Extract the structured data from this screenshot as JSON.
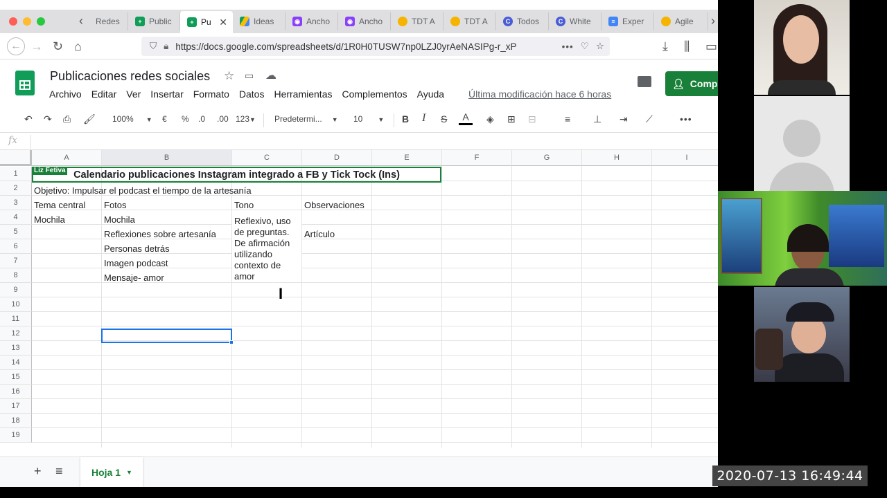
{
  "browser": {
    "tabs": [
      {
        "label": "Redes",
        "icon": "back-arrow",
        "color": "#9aa0a6"
      },
      {
        "label": "Public",
        "icon": "sheets-icon",
        "color": "#0f9d58"
      },
      {
        "label": "Pu",
        "icon": "sheets-icon",
        "color": "#0f9d58"
      },
      {
        "label": "Ideas",
        "icon": "drive-icon",
        "color": "#fbbc04"
      },
      {
        "label": "Ancho",
        "icon": "anchor-icon",
        "color": "#8940fa"
      },
      {
        "label": "Ancho",
        "icon": "anchor-icon",
        "color": "#8940fa"
      },
      {
        "label": "TDT A",
        "icon": "medal-icon",
        "color": "#f4b400"
      },
      {
        "label": "TDT A",
        "icon": "medal-icon",
        "color": "#f4b400"
      },
      {
        "label": "Todos",
        "icon": "c-icon",
        "color": "#4a5cd6"
      },
      {
        "label": "White",
        "icon": "c-icon",
        "color": "#4a5cd6"
      },
      {
        "label": "Exper",
        "icon": "docs-icon",
        "color": "#4285f4"
      },
      {
        "label": "Agile",
        "icon": "medal-icon",
        "color": "#f4b400"
      }
    ],
    "url": "https://docs.google.com/spreadsheets/d/1R0H0TUSW7np0LZJ0yrAeNASIPg-r_xP"
  },
  "sheet": {
    "title": "Publicaciones redes sociales",
    "menu": [
      "Archivo",
      "Editar",
      "Ver",
      "Insertar",
      "Formato",
      "Datos",
      "Herramientas",
      "Complementos",
      "Ayuda"
    ],
    "last_modified": "Última modificación hace 6 horas",
    "share_label": "Compa",
    "toolbar": {
      "zoom": "100%",
      "currency": "€",
      "percent": "%",
      "dec_less": ".0",
      "dec_more": ".00",
      "format_more": "123",
      "font": "Predetermi...",
      "font_size": "10",
      "bold": "B",
      "italic": "I",
      "strike": "S",
      "text_color": "A"
    },
    "fx": "fx",
    "columns": [
      "A",
      "B",
      "C",
      "D",
      "E",
      "F",
      "G",
      "H",
      "I"
    ],
    "rows": [
      "1",
      "2",
      "3",
      "4",
      "5",
      "6",
      "7",
      "8",
      "9",
      "10",
      "11",
      "12",
      "13",
      "14",
      "15",
      "16",
      "17",
      "18",
      "19"
    ],
    "collaborator_flag": "Liz Fetiva",
    "title_cell": "Calendario publicaciones Instagram integrado a FB y Tick Tock (Ins)",
    "objective": "Objetivo: Impulsar el podcast el tiempo de la artesanía",
    "headers": {
      "a": "Tema central",
      "b": "Fotos",
      "c": "Tono",
      "d": "Observaciones"
    },
    "a4": "Mochila",
    "b_items": [
      "Mochila",
      "Reflexiones sobre artesanía",
      "Personas detrás",
      "Imagen podcast",
      "Mensaje- amor"
    ],
    "tono": "Reflexivo, uso de preguntas. De afirmación utilizando contexto de amor",
    "d5": "Artículo",
    "sheet_tab": "Hoja 1"
  },
  "timestamp": "2020-07-13 16:49:44"
}
